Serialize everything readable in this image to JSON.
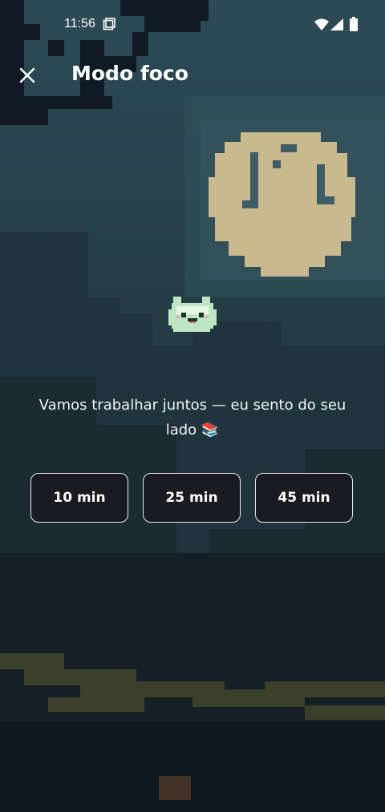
{
  "status_bar": {
    "time": "11:56"
  },
  "header": {
    "title": "Modo foco",
    "close_icon": "close-icon"
  },
  "message": "Vamos trabalhar juntos — eu sento do seu lado 📚",
  "durations": [
    {
      "label": "10 min"
    },
    {
      "label": "25 min"
    },
    {
      "label": "45 min"
    }
  ],
  "colors": {
    "sky_top": "#2b4751",
    "sky_bottom": "#16232a",
    "moon": "#c8b98f",
    "button_bg": "#1a1b20",
    "button_border": "#e8edf0",
    "companion": "#bfe6c4"
  }
}
